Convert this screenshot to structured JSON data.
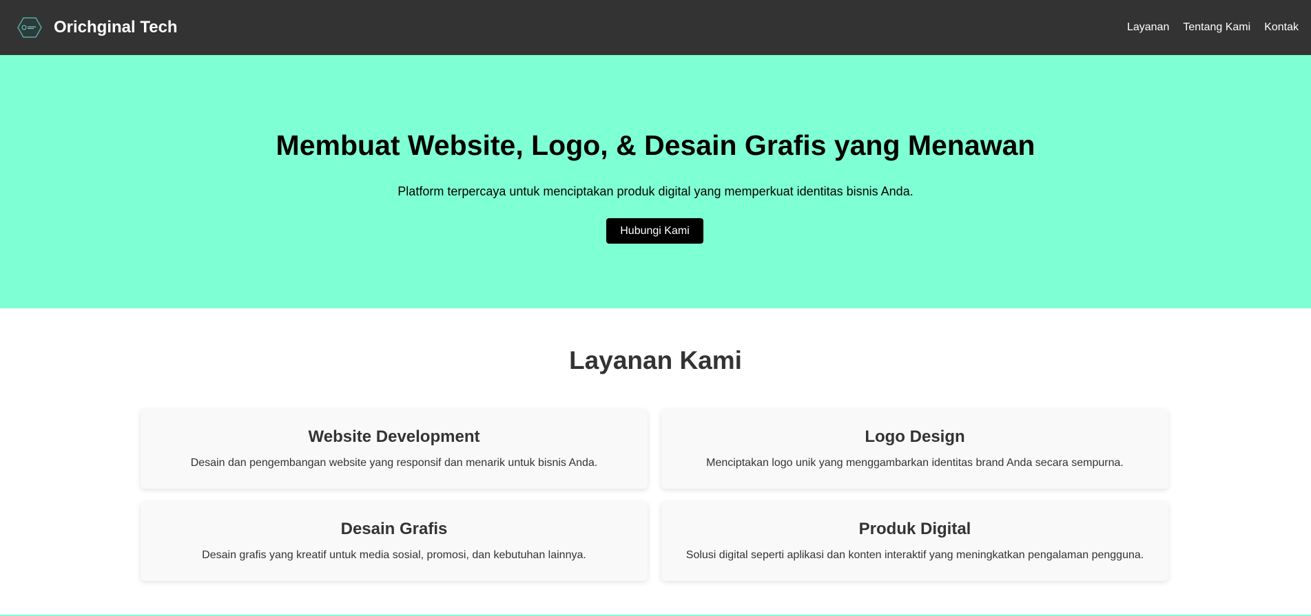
{
  "header": {
    "logo_icon": "hexagon-logo-icon",
    "brand_name": "Orichginal Tech",
    "nav": [
      {
        "label": "Layanan"
      },
      {
        "label": "Tentang Kami"
      },
      {
        "label": "Kontak"
      }
    ]
  },
  "hero": {
    "title": "Membuat Website, Logo, & Desain Grafis yang Menawan",
    "subtitle": "Platform terpercaya untuk menciptakan produk digital yang memperkuat identitas bisnis Anda.",
    "cta_label": "Hubungi Kami",
    "background_color": "#7fffd4"
  },
  "services": {
    "title": "Layanan Kami",
    "items": [
      {
        "title": "Website Development",
        "description": "Desain dan pengembangan website yang responsif dan menarik untuk bisnis Anda."
      },
      {
        "title": "Logo Design",
        "description": "Menciptakan logo unik yang menggambarkan identitas brand Anda secara sempurna."
      },
      {
        "title": "Desain Grafis",
        "description": "Desain grafis yang kreatif untuk media sosial, promosi, dan kebutuhan lainnya."
      },
      {
        "title": "Produk Digital",
        "description": "Solusi digital seperti aplikasi dan konten interaktif yang meningkatkan pengalaman pengguna."
      }
    ]
  },
  "colors": {
    "header_bg": "#333333",
    "accent": "#7fffd4",
    "button_bg": "#000000"
  }
}
